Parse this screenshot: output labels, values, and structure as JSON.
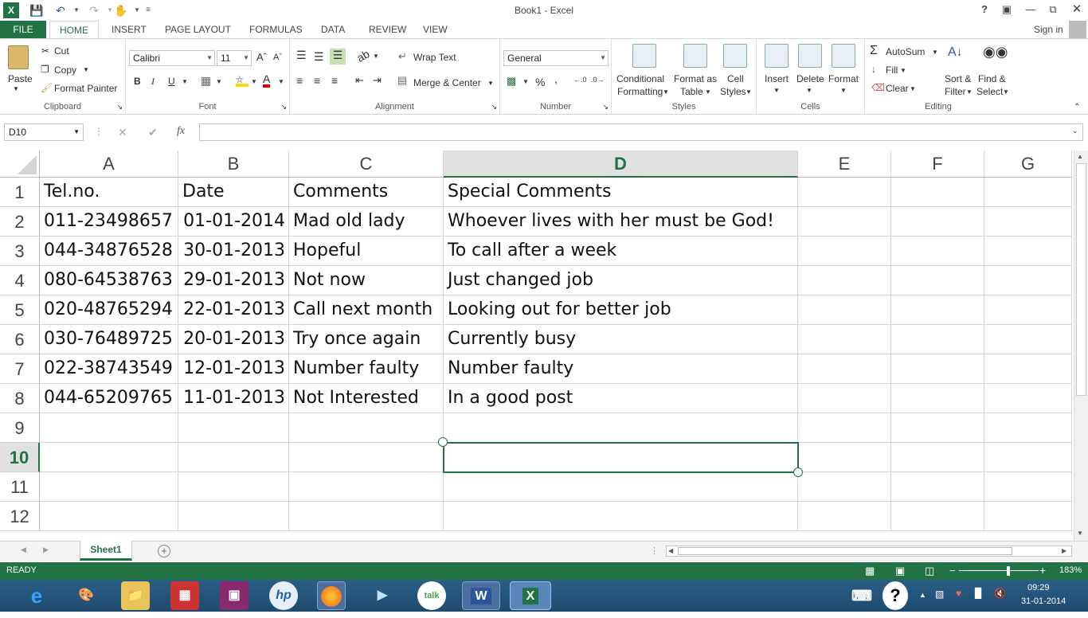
{
  "window": {
    "title": "Book1 - Excel",
    "help": "?",
    "signin": "Sign in"
  },
  "tabs": [
    "FILE",
    "HOME",
    "INSERT",
    "PAGE LAYOUT",
    "FORMULAS",
    "DATA",
    "REVIEW",
    "VIEW"
  ],
  "clipboard": {
    "paste": "Paste",
    "cut": "Cut",
    "copy": "Copy",
    "format_painter": "Format Painter",
    "label": "Clipboard"
  },
  "font": {
    "name": "Calibri",
    "size": "11",
    "bold": "B",
    "italic": "I",
    "underline": "U",
    "label": "Font"
  },
  "alignment": {
    "wrap": "Wrap Text",
    "merge": "Merge & Center",
    "label": "Alignment"
  },
  "number": {
    "format": "General",
    "percent": "%",
    "comma": ",",
    "label": "Number"
  },
  "styles": {
    "conditional_1": "Conditional",
    "conditional_2": "Formatting",
    "format_table_1": "Format as",
    "format_table_2": "Table",
    "cell_styles_1": "Cell",
    "cell_styles_2": "Styles",
    "label": "Styles"
  },
  "cells": {
    "insert": "Insert",
    "delete": "Delete",
    "format": "Format",
    "label": "Cells"
  },
  "editing": {
    "autosum": "AutoSum",
    "fill": "Fill",
    "clear": "Clear",
    "sort_1": "Sort &",
    "sort_2": "Filter",
    "find_1": "Find &",
    "find_2": "Select",
    "label": "Editing"
  },
  "formula_bar": {
    "name_box": "D10",
    "fx": "fx",
    "cancel": "✕",
    "enter": "✔",
    "value": ""
  },
  "columns": [
    "A",
    "B",
    "C",
    "D",
    "E",
    "F",
    "G"
  ],
  "selected_column": "D",
  "rows": [
    "1",
    "2",
    "3",
    "4",
    "5",
    "6",
    "7",
    "8",
    "9",
    "10",
    "11",
    "12"
  ],
  "selected_row": "10",
  "table": [
    [
      "Tel.no.",
      "Date",
      "Comments",
      "Special Comments"
    ],
    [
      "011-23498657",
      "01-01-2014",
      "Mad old lady",
      "Whoever lives with her must be God!"
    ],
    [
      "044-34876528",
      "30-01-2013",
      "Hopeful",
      "To call after a week"
    ],
    [
      "080-64538763",
      "29-01-2013",
      "Not now",
      "Just changed job"
    ],
    [
      "020-48765294",
      "22-01-2013",
      "Call next month",
      "Looking out for better job"
    ],
    [
      "030-76489725",
      "20-01-2013",
      "Try once again",
      "Currently busy"
    ],
    [
      "022-38743549",
      "12-01-2013",
      "Number faulty",
      "Number faulty"
    ],
    [
      "044-65209765",
      "11-01-2013",
      "Not Interested",
      "In a good post"
    ]
  ],
  "sheet": {
    "tab": "Sheet1",
    "add": "+"
  },
  "status": {
    "mode": "READY",
    "zoom": "183%"
  },
  "taskbar": {
    "time": "09:29",
    "date": "31-01-2014",
    "hp": "hp",
    "talk": "talk"
  },
  "colors": {
    "excel_green": "#217346",
    "selection": "#217346",
    "taskbar": "#2c5f86"
  }
}
